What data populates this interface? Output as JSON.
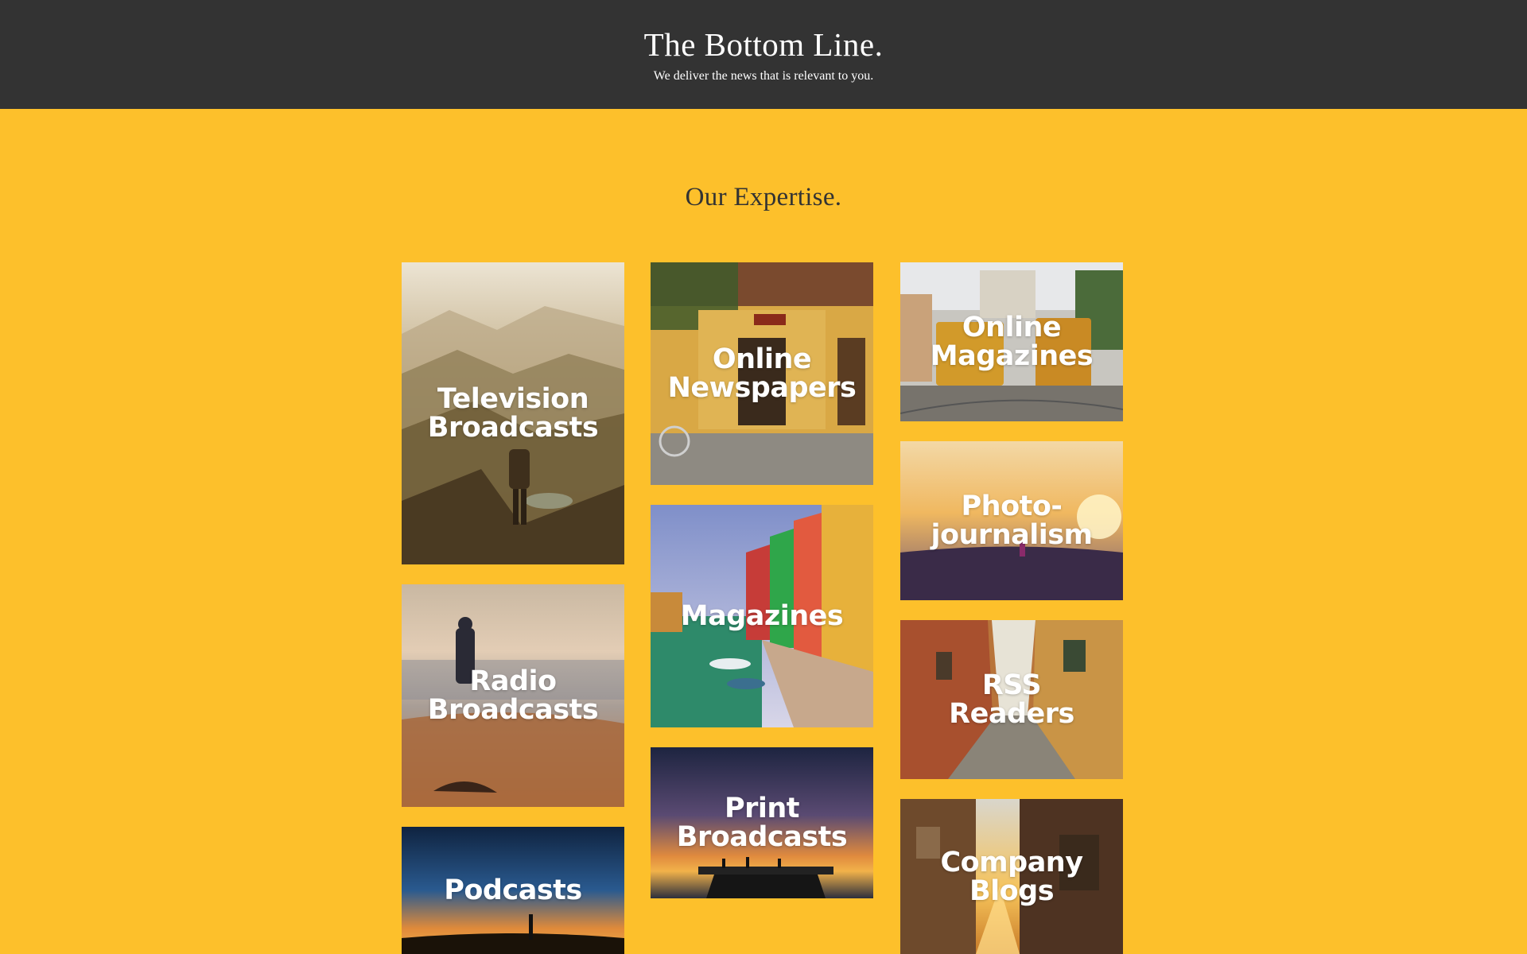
{
  "header": {
    "title": "The Bottom Line.",
    "tagline": "We deliver the news that is relevant to you.",
    "background": "#333333"
  },
  "page": {
    "background": "#fdc02b"
  },
  "expertise": {
    "heading": "Our Expertise.",
    "tiles": [
      {
        "label": "Television\nBroadcasts",
        "image": "mountain-hiker-image"
      },
      {
        "label": "Radio\nBroadcasts",
        "image": "beach-fisherman-image"
      },
      {
        "label": "Podcasts",
        "image": "sunset-silhouette-image"
      },
      {
        "label": "Online\nNewspapers",
        "image": "yellow-storefront-image"
      },
      {
        "label": "Magazines",
        "image": "canal-houses-image"
      },
      {
        "label": "Print\nBroadcasts",
        "image": "pier-sunset-image"
      },
      {
        "label": "Online\nMagazines",
        "image": "city-trams-image"
      },
      {
        "label": "Photo-\njournalism",
        "image": "field-runner-image"
      },
      {
        "label": "RSS\nReaders",
        "image": "cobblestone-alley-image"
      },
      {
        "label": "Company\nBlogs",
        "image": "sunlit-street-image"
      }
    ]
  }
}
